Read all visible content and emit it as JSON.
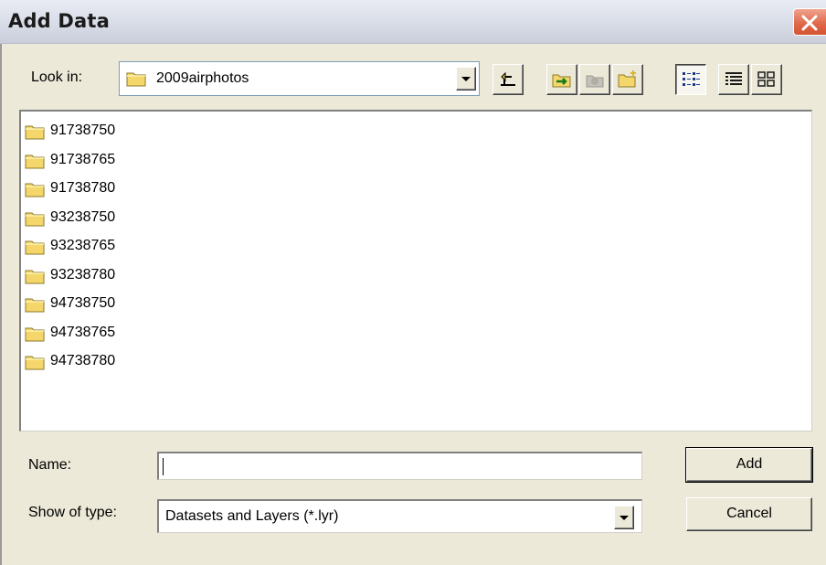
{
  "window": {
    "title": "Add Data",
    "close_icon": "close-icon"
  },
  "look_in": {
    "label": "Look in:",
    "value": "2009airphotos",
    "icon": "folder-icon"
  },
  "toolbar": [
    {
      "name": "up-one-level-button",
      "icon": "up-folder-icon",
      "enabled": true
    },
    {
      "name": "connect-to-folder-button",
      "icon": "connect-folder-icon",
      "enabled": true
    },
    {
      "name": "disconnect-folder-button",
      "icon": "disconnect-folder-icon",
      "enabled": false
    },
    {
      "name": "new-folder-button",
      "icon": "new-folder-icon",
      "enabled": true
    },
    {
      "name": "list-view-button",
      "icon": "list-view-icon",
      "pressed": true
    },
    {
      "name": "details-view-button",
      "icon": "details-view-icon",
      "pressed": false
    },
    {
      "name": "thumbnails-view-button",
      "icon": "thumbnails-view-icon",
      "pressed": false
    }
  ],
  "files": [
    {
      "name": "91738750",
      "icon": "folder-icon"
    },
    {
      "name": "91738765",
      "icon": "folder-icon"
    },
    {
      "name": "91738780",
      "icon": "folder-icon"
    },
    {
      "name": "93238750",
      "icon": "folder-icon"
    },
    {
      "name": "93238765",
      "icon": "folder-icon"
    },
    {
      "name": "93238780",
      "icon": "folder-icon"
    },
    {
      "name": "94738750",
      "icon": "folder-icon"
    },
    {
      "name": "94738765",
      "icon": "folder-icon"
    },
    {
      "name": "94738780",
      "icon": "folder-icon"
    }
  ],
  "name_field": {
    "label": "Name:",
    "value": ""
  },
  "type_field": {
    "label": "Show of type:",
    "value": "Datasets and Layers (*.lyr)"
  },
  "buttons": {
    "add": "Add",
    "cancel": "Cancel"
  },
  "colors": {
    "dialog_bg": "#ece9d8",
    "close_red": "#e06a4c",
    "folder_yellow": "#f5d66a"
  }
}
